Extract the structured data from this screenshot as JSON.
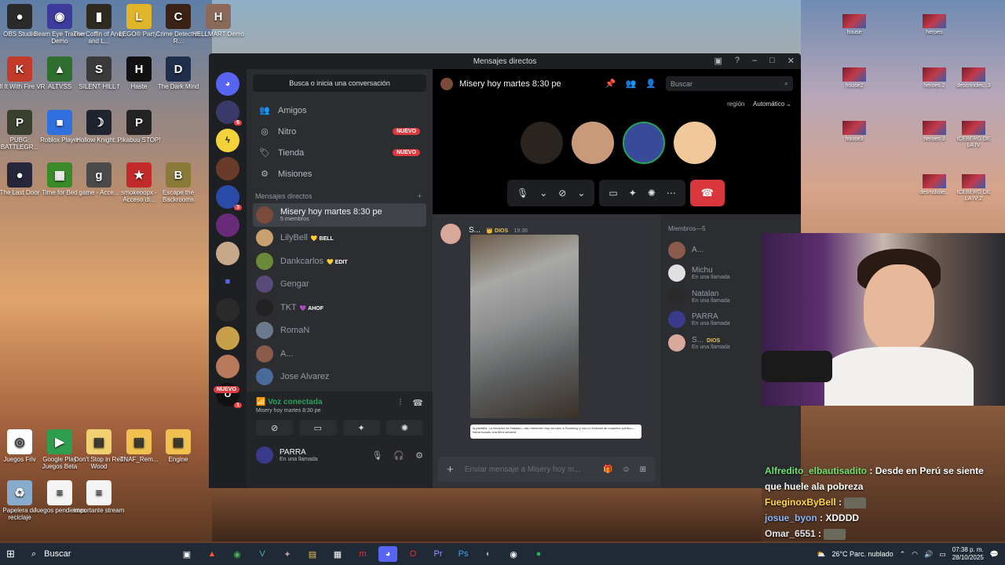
{
  "desktop": {
    "left_icons": [
      {
        "label": "OBS Studio",
        "color": "#2a2a2a",
        "glyph": "●"
      },
      {
        "label": "Beam Eye Tracker Demo",
        "color": "#3d3b9c",
        "glyph": "◉"
      },
      {
        "label": "The Coffin of Andy and L...",
        "color": "#2e2a22",
        "glyph": "▮"
      },
      {
        "label": "LEGO® Party!",
        "color": "#e0b52a",
        "glyph": "L"
      },
      {
        "label": "Crime Detective R...",
        "color": "#3a2216",
        "glyph": "C"
      },
      {
        "label": "HELLMART Demo",
        "color": "#8b6a5a",
        "glyph": "H"
      },
      {
        "label": "Kill It With Fire VR",
        "color": "#c43a2a",
        "glyph": "K"
      },
      {
        "label": "ALTVSS",
        "color": "#2e6e2e",
        "glyph": "▲"
      },
      {
        "label": "SILENT HILL f",
        "color": "#3a3a3a",
        "glyph": "S"
      },
      {
        "label": "Haste",
        "color": "#111111",
        "glyph": "H"
      },
      {
        "label": "The Dark Mind",
        "color": "#1f2e4a",
        "glyph": "D"
      },
      {
        "label": "PUBG: BATTLEGR...",
        "color": "#3a3f2e",
        "glyph": "P"
      },
      {
        "label": "Roblox Player",
        "color": "#2f6fde",
        "glyph": "■"
      },
      {
        "label": "Hollow Knight:...",
        "color": "#20242e",
        "glyph": "☽"
      },
      {
        "label": "Pikabuu STOP!",
        "color": "#242424",
        "glyph": "P"
      },
      {
        "label": "The Last Door",
        "color": "#26263a",
        "glyph": "●"
      },
      {
        "label": "Time for Bed",
        "color": "#3a8a2a",
        "glyph": "▦"
      },
      {
        "label": "game - Acce...",
        "color": "#4a4a4a",
        "glyph": "g"
      },
      {
        "label": "smokeoopx - Acceso di...",
        "color": "#c22a2a",
        "glyph": "★"
      },
      {
        "label": "Escape the Backrooms",
        "color": "#8a7a3a",
        "glyph": "B"
      },
      {
        "label": "Juegos Friv",
        "color": "#ffffff",
        "glyph": "◎"
      },
      {
        "label": "Google Play Juegos Beta",
        "color": "#2e9e4e",
        "glyph": "▶"
      },
      {
        "label": "Don't Stop in Red Wood",
        "color": "#f0d070",
        "glyph": "▤"
      },
      {
        "label": "TNAF_Rem...",
        "color": "#f0c050",
        "glyph": "▤"
      },
      {
        "label": "Engine",
        "color": "#f0c050",
        "glyph": "▤"
      },
      {
        "label": "Papelera de reciclaje",
        "color": "#88aacc",
        "glyph": "♻"
      },
      {
        "label": "Juegos pendientes",
        "color": "#f4f4f4",
        "glyph": "≡"
      },
      {
        "label": "importante stream",
        "color": "#f4f4f4",
        "glyph": "≡"
      }
    ],
    "right_icons": [
      {
        "label": "house"
      },
      {
        "label": "heroes"
      },
      {
        "label": "house2"
      },
      {
        "label": "heroes 2"
      },
      {
        "label": "descriridiei...3"
      },
      {
        "label": "house3"
      },
      {
        "label": "heroes 3"
      },
      {
        "label": "ICEBERG DE LA IV"
      },
      {
        "label": "desmdidie..."
      },
      {
        "label": "ICEBERG DE LA IV 2"
      }
    ]
  },
  "discord": {
    "window_title": "Mensajes directos",
    "search_top": "Busca o inicia una conversación",
    "nav": [
      {
        "label": "Amigos",
        "icon": "👥",
        "badge": ""
      },
      {
        "label": "Nitro",
        "icon": "◎",
        "badge": "NUEVO"
      },
      {
        "label": "Tienda",
        "icon": "🏷",
        "badge": "NUEVO"
      },
      {
        "label": "Misiones",
        "icon": "⚙",
        "badge": ""
      }
    ],
    "dm_header": "Mensajes directos",
    "dm_add": "+",
    "dms": [
      {
        "name": "Misery hoy martes 8:30 pe",
        "sub": "5 miembros",
        "tag": "",
        "color": "#7a4a3a",
        "active": true
      },
      {
        "name": "LilyBell",
        "sub": "",
        "tag": "💛 BELL",
        "color": "#c8a070"
      },
      {
        "name": "Dankcarlos",
        "sub": "",
        "tag": "💛 EDIT",
        "color": "#6a8a3a"
      },
      {
        "name": "Gengar",
        "sub": "",
        "tag": "",
        "color": "#5a4a7a"
      },
      {
        "name": "TKT",
        "sub": "",
        "tag": "💜 AHOF",
        "color": "#222222"
      },
      {
        "name": "RomaN",
        "sub": "",
        "tag": "",
        "color": "#6a7a8a"
      },
      {
        "name": "A...",
        "sub": "",
        "tag": "",
        "color": "#8a5a4a"
      },
      {
        "name": "Jose Alvarez",
        "sub": "",
        "tag": "",
        "color": "#4a6a9a"
      }
    ],
    "guild_new_badge": "NUEVO",
    "voice": {
      "status": "Voz conectada",
      "channel": "Misery hoy martes 8:30 pe"
    },
    "user": {
      "name": "PARRA",
      "status": "En una llamada"
    },
    "channel": {
      "title": "Misery hoy martes 8:30 pe",
      "search_placeholder": "Buscar",
      "region_label": "región",
      "region_value": "Automático"
    },
    "message": {
      "author": "S...",
      "role": "DIOS",
      "time": "19:36",
      "attachment_text": "la pantalla. La mención de Natalan—otro streamer muy cercano a Scanning y con un historial de coqueteo público—había tocado una fibra sensible"
    },
    "composer_placeholder": "Enviar mensaje a Misery hoy m...",
    "members_header": "Miembros—5",
    "members": [
      {
        "name": "A...",
        "status": "",
        "color": "#8a5a4a"
      },
      {
        "name": "Michu",
        "status": "En una llamada",
        "color": "#e0e0e0"
      },
      {
        "name": "Natalan",
        "status": "En una llamada",
        "color": "#2a2a2a"
      },
      {
        "name": "PARRA",
        "status": "En una llamada",
        "color": "#3a3a8a"
      },
      {
        "name": "S...",
        "status": "En una llamada",
        "color": "#d8a89a",
        "role": "DIOS"
      }
    ],
    "call_avatars": [
      "#2a2420",
      "#c89a7a",
      "#3a4a9a",
      "#f0c89a"
    ]
  },
  "stream_chat": [
    {
      "user": "Alfredito_elbautisadito",
      "text": "Desde en Perú se siente que huele ala pobreza"
    },
    {
      "user": "FueginoxByBell",
      "text": ""
    },
    {
      "user": "josue_byon",
      "text": "XDDDD"
    },
    {
      "user": "Omar_6551",
      "text": ""
    }
  ],
  "taskbar": {
    "search": "Buscar",
    "weather": "26°C  Parc. nublado",
    "time": "07:38 p. m.",
    "date": "28/10/2025"
  }
}
